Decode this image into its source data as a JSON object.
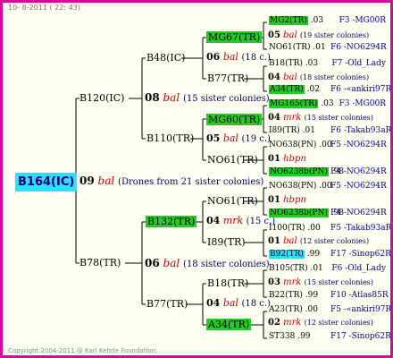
{
  "header": {
    "date_text": "10-  8-2011 ( 22: 43)"
  },
  "footer": {
    "copyright": "Copyright 2004-2011 @ Karl Kehrle Foundation."
  },
  "root": {
    "id": "B164(IC)"
  },
  "gen1": {
    "year": "09",
    "breed": "bal",
    "note": "(Drones from 21 sister colonies)"
  },
  "dam": {
    "B120": "B120(IC)",
    "B78": "B78(TR)"
  },
  "gen2": {
    "top": {
      "year": "08",
      "breed": "bal",
      "note": "(15 sister colonies)"
    },
    "bottom": {
      "year": "06",
      "breed": "bal",
      "note": "(18 sister colonies)"
    }
  },
  "level2": {
    "b48": "B48(IC)",
    "b110": "B110(TR)",
    "b132": "B132(TR)",
    "b77": "B77(TR)"
  },
  "gen3": {
    "a": {
      "year": "06",
      "breed": "bal",
      "note": "(18 c.)"
    },
    "b": {
      "year": "05",
      "breed": "bal",
      "note": "(19 c.)"
    },
    "c": {
      "year": "04",
      "breed": "mrk",
      "note": "(15 c.)"
    },
    "d": {
      "year": "04",
      "breed": "bal",
      "note": "(18 c.)"
    }
  },
  "level3": {
    "mg67": "MG67(TR)",
    "b77tr": "B77(TR)",
    "mg60": "MG60(TR)",
    "no61a": "NO61(TR)",
    "no61b": "NO61(TR)",
    "i89": "I89(TR)",
    "b18": "B18(TR)",
    "a34": "A34(TR)"
  },
  "gen4": {
    "g1": {
      "year": "05",
      "breed": "bal",
      "note": "(19 sister colonies)"
    },
    "g2": {
      "year": "04",
      "breed": "bal",
      "note": "(18 sister colonies)"
    },
    "g3": {
      "year": "04",
      "breed": "mrk",
      "note": "(15 sister colonies)"
    },
    "g4": {
      "year": "01",
      "breed": "hbpn",
      "note": ""
    },
    "g5": {
      "year": "01",
      "breed": "hbpn",
      "note": ""
    },
    "g6": {
      "year": "01",
      "breed": "bal",
      "note": "(12 sister colonies)"
    },
    "g7": {
      "year": "03",
      "breed": "mrk",
      "note": "(15 sister colonies)"
    },
    "g8": {
      "year": "02",
      "breed": "mrk",
      "note": "(12 sister colonies)"
    }
  },
  "leaves": [
    {
      "id": "MG2(TR)",
      "yr": ".03",
      "ref": "F3 -MG00R",
      "hl": "green"
    },
    {
      "id": "NO61(TR)",
      "yr": ".01",
      "ref": "F6 -NO6294R",
      "hl": ""
    },
    {
      "id": "B18(TR)",
      "yr": ".03",
      "ref": "F7 -Old_Lady",
      "hl": ""
    },
    {
      "id": "A34(TR)",
      "yr": ".02",
      "ref": "F6 -«ankiri97R",
      "hl": "green"
    },
    {
      "id": "MG165(TR)",
      "yr": ".03",
      "ref": "F3 -MG00R",
      "hl": "green"
    },
    {
      "id": "I89(TR)",
      "yr": ".01",
      "ref": "F6 -Takab93aR",
      "hl": ""
    },
    {
      "id": "NO638(PN)",
      "yr": ".00",
      "ref": "F5 -NO6294R",
      "hl": ""
    },
    {
      "id": "NO6238b(PN)",
      "yr": ".98",
      "ref": "F4 -NO6294R",
      "hl": "green"
    },
    {
      "id": "NO638(PN)",
      "yr": ".00",
      "ref": "F5 -NO6294R",
      "hl": ""
    },
    {
      "id": "NO6238b(PN)",
      "yr": ".98",
      "ref": "F4 -NO6294R",
      "hl": "green"
    },
    {
      "id": "I100(TR)",
      "yr": ".00",
      "ref": "F5 -Takab93aR",
      "hl": ""
    },
    {
      "id": "B92(TR)",
      "yr": ".99",
      "ref": "F17 -Sinop62R",
      "hl": "cyan"
    },
    {
      "id": "B105(TR)",
      "yr": ".01",
      "ref": "F6 -Old_Lady",
      "hl": ""
    },
    {
      "id": "B22(TR)",
      "yr": ".99",
      "ref": "F10 -Atlas85R",
      "hl": ""
    },
    {
      "id": "A23(TR)",
      "yr": ".00",
      "ref": "F5 -«ankiri97R",
      "hl": ""
    },
    {
      "id": "ST338",
      "yr": ".99",
      "ref": "F17 -Sinop62R",
      "hl": ""
    }
  ],
  "colors": {
    "border": "#e0009a",
    "root_bg": "#33ddff",
    "green_hl": "#22cc22",
    "breed_red": "#cc0000",
    "note_navy": "#000066"
  }
}
